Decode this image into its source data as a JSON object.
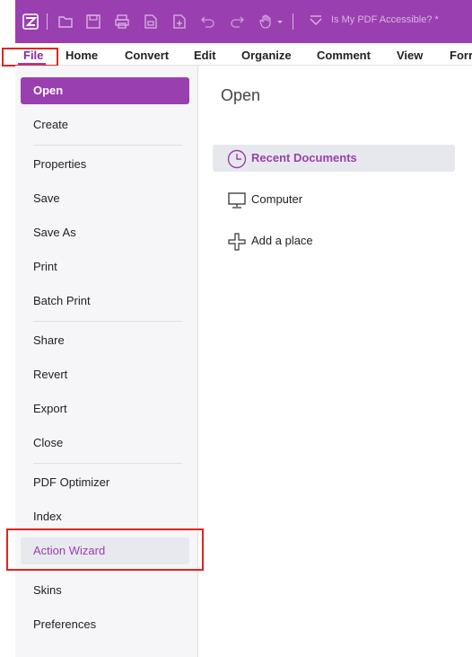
{
  "titlebar": {
    "doc_title": "Is My PDF Accessible? *",
    "icons": [
      "app-logo-icon",
      "open-folder-icon",
      "save-icon",
      "print-icon",
      "scan-icon",
      "new-file-icon",
      "undo-icon",
      "redo-icon",
      "hand-tool-icon",
      "customize-toolbar-icon"
    ],
    "accent_color": "#9a3fb0"
  },
  "menubar": {
    "items": [
      "File",
      "Home",
      "Convert",
      "Edit",
      "Organize",
      "Comment",
      "View",
      "Forr"
    ]
  },
  "sidebar": {
    "items": [
      "Open",
      "Create",
      "Properties",
      "Save",
      "Save As",
      "Print",
      "Batch Print",
      "Share",
      "Revert",
      "Export",
      "Close",
      "PDF Optimizer",
      "Index",
      "Action Wizard",
      "Skins",
      "Preferences"
    ],
    "active": "Open",
    "highlighted": "Action Wizard"
  },
  "main": {
    "title": "Open",
    "options": [
      "Recent Documents",
      "Computer",
      "Add a place"
    ]
  },
  "annotation_color": "#e0241f"
}
